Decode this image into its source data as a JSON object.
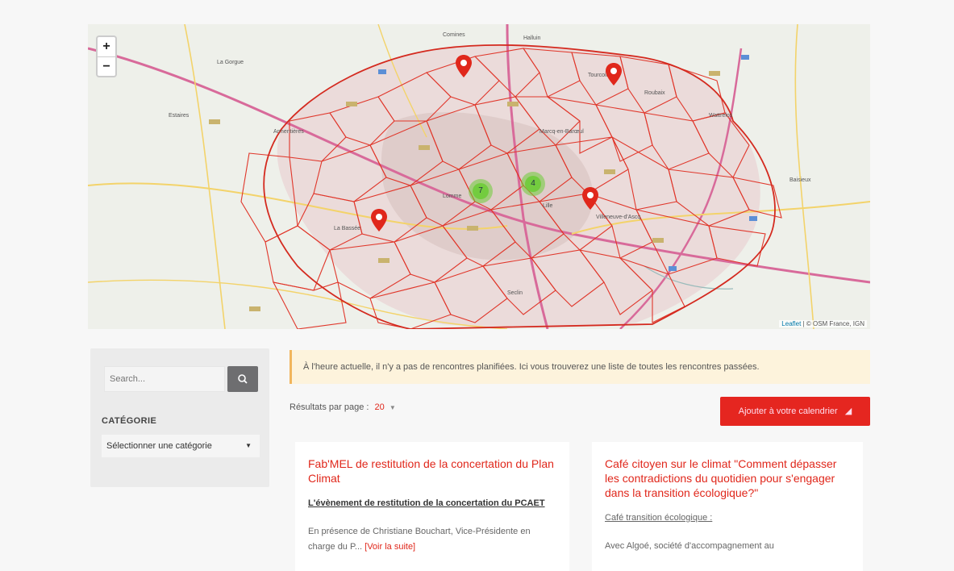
{
  "map": {
    "zoom_in": "+",
    "zoom_out": "−",
    "attribution_link": "Leaflet",
    "attribution_text": "| © OSM France, IGN",
    "cities": [
      "La Gorgue",
      "Estaires",
      "La Bassée",
      "Lille",
      "Roubaix",
      "Tourcoing",
      "Armentières",
      "Seclin",
      "Villeneuve-d'Ascq",
      "Halluin",
      "Wattrelos",
      "Lomme",
      "Marcq-en-Barœul",
      "Comines",
      "Baisieux"
    ],
    "markers": [
      "marker-1",
      "marker-2",
      "marker-3",
      "marker-4"
    ],
    "clusters": [
      "7",
      "4"
    ]
  },
  "sidebar": {
    "search_placeholder": "Search...",
    "search_icon": "search-icon",
    "category_label": "CATÉGORIE",
    "category_select": "Sélectionner une catégorie"
  },
  "notice": "À l'heure actuelle, il n'y a pas de rencontres planifiées. Ici vous trouverez une liste de toutes les rencontres passées.",
  "results": {
    "label": "Résultats par page :",
    "value": "20"
  },
  "calendar_button": "Ajouter à votre calendrier",
  "events": [
    {
      "title": "Fab'MEL de restitution de la concertation du Plan Climat",
      "subtitle": "L'évènement de restitution de la concertation du PCAET",
      "excerpt": "En présence de Christiane Bouchart, Vice-Présidente en charge du P...",
      "more": "[Voir la suite]"
    },
    {
      "title": "Café citoyen sur le climat \"Comment dépasser les contradictions du quotidien pour s'engager dans la transition écologique?\"",
      "subtitle": "Café transition écologique :",
      "excerpt": "Avec Algoé, société d'accompagnement au"
    }
  ],
  "colors": {
    "accent": "#e0271b",
    "boundary": "#e0372b",
    "cluster": "#6ecc39",
    "notice_border": "#f1b55c"
  }
}
